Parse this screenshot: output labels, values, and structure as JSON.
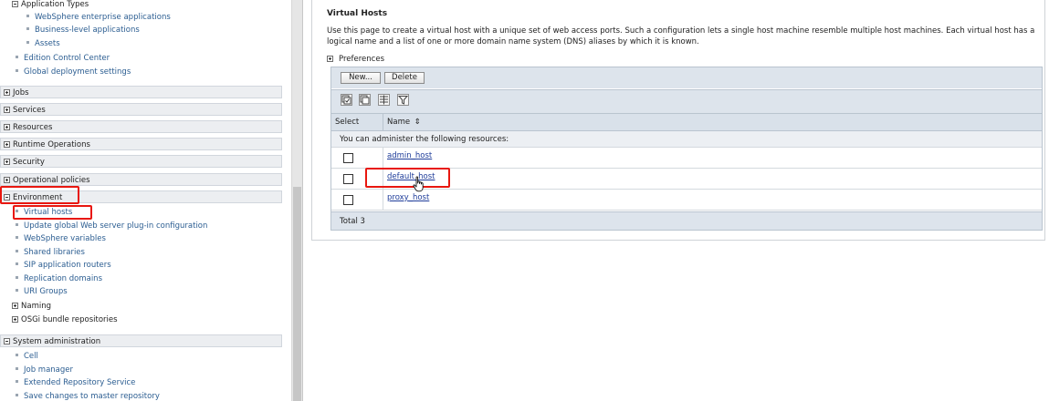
{
  "nav": {
    "app_types": {
      "label": "Application Types",
      "items": [
        {
          "label": "WebSphere enterprise applications"
        },
        {
          "label": "Business-level applications"
        },
        {
          "label": "Assets"
        }
      ]
    },
    "top_items": [
      {
        "label": "Edition Control Center"
      },
      {
        "label": "Global deployment settings"
      }
    ],
    "categories": [
      {
        "label": "Jobs",
        "expanded": false
      },
      {
        "label": "Services",
        "expanded": false
      },
      {
        "label": "Resources",
        "expanded": false
      },
      {
        "label": "Runtime Operations",
        "expanded": false
      },
      {
        "label": "Security",
        "expanded": false
      },
      {
        "label": "Operational policies",
        "expanded": false
      },
      {
        "label": "Environment",
        "expanded": true
      }
    ],
    "environment": {
      "items": [
        {
          "label": "Virtual hosts",
          "selected": true
        },
        {
          "label": "Update global Web server plug-in configuration"
        },
        {
          "label": "WebSphere variables"
        },
        {
          "label": "Shared libraries"
        },
        {
          "label": "SIP application routers"
        },
        {
          "label": "Replication domains"
        },
        {
          "label": "URI Groups"
        }
      ],
      "groups": [
        {
          "label": "Naming"
        },
        {
          "label": "OSGi bundle repositories"
        }
      ]
    },
    "system_admin": {
      "label": "System administration",
      "items": [
        {
          "label": "Cell"
        },
        {
          "label": "Job manager"
        },
        {
          "label": "Extended Repository Service"
        },
        {
          "label": "Save changes to master repository"
        }
      ]
    }
  },
  "main": {
    "title": "Virtual Hosts",
    "description": "Use this page to create a virtual host with a unique set of web access ports. Such a configuration lets a single host machine resemble multiple host machines. Each virtual host has a logical name and a list of one or more domain name system (DNS) aliases by which it is known.",
    "preferences_label": "Preferences",
    "buttons": {
      "new": "New...",
      "delete": "Delete"
    },
    "icon_buttons": [
      "select-all-icon",
      "deselect-all-icon",
      "show-filter-icon",
      "clear-filter-icon"
    ],
    "table": {
      "col_select": "Select",
      "col_name": "Name",
      "sort_glyph": "⇕",
      "info": "You can administer the following resources:",
      "rows": [
        {
          "name": "admin_host"
        },
        {
          "name": "default_host"
        },
        {
          "name": "proxy_host"
        }
      ],
      "total": "Total 3"
    }
  },
  "colors": {
    "highlight_box": "#e8170f",
    "link": "#1f3d9a",
    "nav_link": "#2b5d91",
    "table_header": "#d9e1ea"
  }
}
